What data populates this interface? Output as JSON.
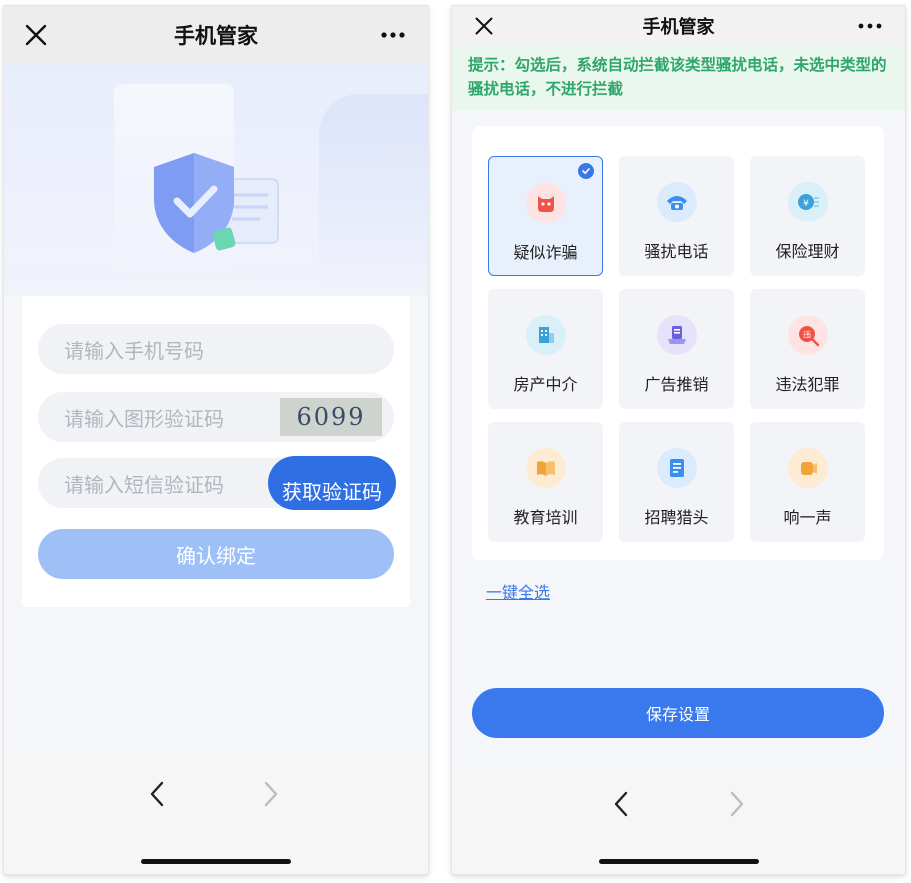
{
  "left": {
    "header": {
      "title": "手机管家",
      "close_icon": "close-icon",
      "more_icon": "more-icon"
    },
    "form": {
      "phone_placeholder": "请输入手机号码",
      "captcha_placeholder": "请输入图形验证码",
      "captcha_code": "6099",
      "sms_placeholder": "请输入短信验证码",
      "sms_button": "获取验证码",
      "confirm_button": "确认绑定"
    }
  },
  "right": {
    "header": {
      "title": "手机管家",
      "close_icon": "close-icon",
      "more_icon": "more-icon"
    },
    "tip": "提示：勾选后，系统自动拦截该类型骚扰电话，未选中类型的骚扰电话，不进行拦截",
    "categories": [
      {
        "label": "疑似诈骗",
        "icon": "fraud-icon",
        "selected": true,
        "color": "#f0524a"
      },
      {
        "label": "骚扰电话",
        "icon": "harass-phone-icon",
        "selected": false,
        "color": "#3a8ef0"
      },
      {
        "label": "保险理财",
        "icon": "insurance-icon",
        "selected": false,
        "color": "#3aa2d8"
      },
      {
        "label": "房产中介",
        "icon": "real-estate-icon",
        "selected": false,
        "color": "#3aa2d8"
      },
      {
        "label": "广告推销",
        "icon": "advertising-icon",
        "selected": false,
        "color": "#6a5fe0"
      },
      {
        "label": "违法犯罪",
        "icon": "crime-icon",
        "selected": false,
        "color": "#f0524a"
      },
      {
        "label": "教育培训",
        "icon": "education-icon",
        "selected": false,
        "color": "#f2a33a"
      },
      {
        "label": "招聘猎头",
        "icon": "recruit-icon",
        "selected": false,
        "color": "#3a8ef0"
      },
      {
        "label": "响一声",
        "icon": "ring-once-icon",
        "selected": false,
        "color": "#f2a33a"
      }
    ],
    "select_all": "一键全选",
    "save_button": "保存设置"
  },
  "colors": {
    "primary": "#3a78ee",
    "tip_text": "#2fa66a",
    "tip_bg": "#eaf7ee"
  }
}
